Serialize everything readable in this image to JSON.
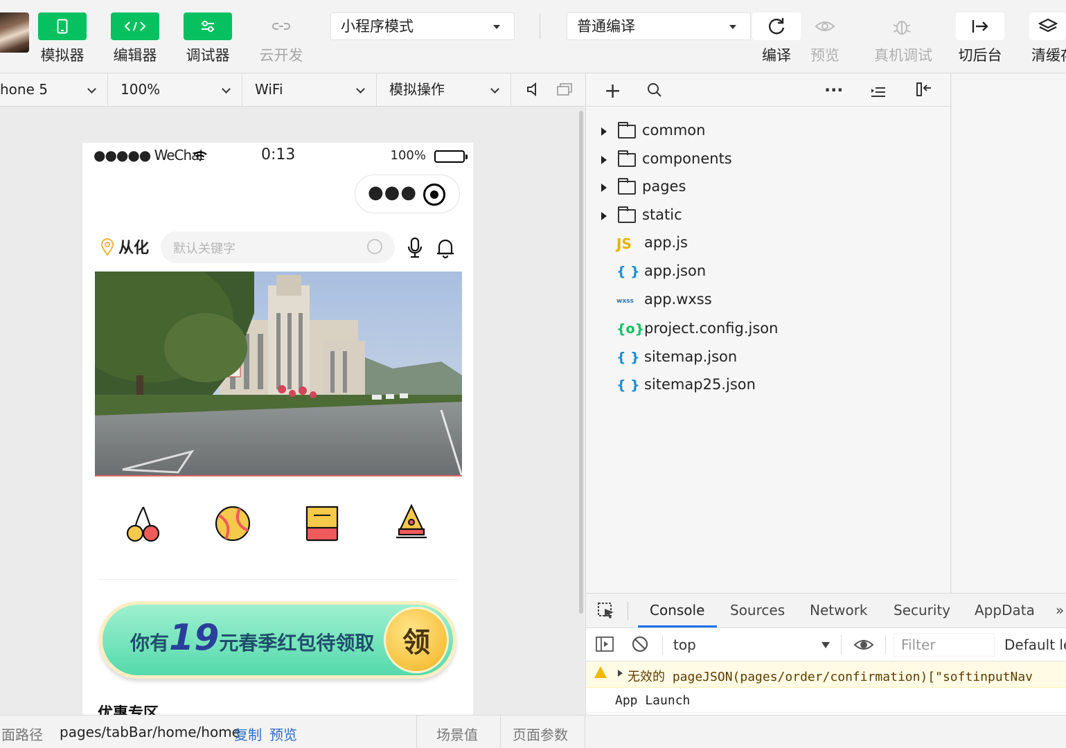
{
  "toolbar": {
    "simulator_label": "模拟器",
    "editor_label": "编辑器",
    "debugger_label": "调试器",
    "cloud_label": "云开发",
    "mode_select": "小程序模式",
    "compile_select": "普通编译",
    "compile_label": "编译",
    "preview_label": "预览",
    "remote_debug_label": "真机调试",
    "background_label": "切后台",
    "clear_cache_label": "清缓存"
  },
  "simbar": {
    "device": "hone 5",
    "zoom": "100%",
    "network": "WiFi",
    "operation": "模拟操作"
  },
  "phone": {
    "carrier": "●●●●● WeChat",
    "time": "0:13",
    "battery_text": "100%",
    "battery_level": 1.0,
    "location": "从化",
    "search_placeholder": "默认关键字",
    "promo_prefix": "你有",
    "promo_amount": "19",
    "promo_suffix": "元春季红包待领取",
    "promo_button": "领",
    "section_title": "优惠专区"
  },
  "explorer": {
    "folders": [
      "common",
      "components",
      "pages",
      "static"
    ],
    "files": [
      {
        "icon": "JS",
        "type": "js",
        "name": "app.js"
      },
      {
        "icon": "{ }",
        "type": "json",
        "name": "app.json"
      },
      {
        "icon": "wxss",
        "type": "wxss",
        "name": "app.wxss"
      },
      {
        "icon": "{o}",
        "type": "cfg",
        "name": "project.config.json"
      },
      {
        "icon": "{ }",
        "type": "json",
        "name": "sitemap.json"
      },
      {
        "icon": "{ }",
        "type": "json",
        "name": "sitemap25.json"
      }
    ]
  },
  "console": {
    "tabs": [
      "Console",
      "Sources",
      "Network",
      "Security",
      "AppData"
    ],
    "more": "»",
    "context": "top",
    "filter_placeholder": "Filter",
    "levels": "Default le",
    "warning_text": "无效的 pageJSON(pages/order/confirmation)[\"softinputNav",
    "log_text": "App Launch"
  },
  "bottombar": {
    "path_label": "面路径",
    "path": "pages/tabBar/home/home",
    "copy": "复制",
    "preview": "预览",
    "scene": "场景值",
    "params": "页面参数"
  },
  "colors": {
    "accent_green": "#07c160",
    "link_blue": "#2b6cc4",
    "console_tab_underline": "#1a73e8"
  }
}
